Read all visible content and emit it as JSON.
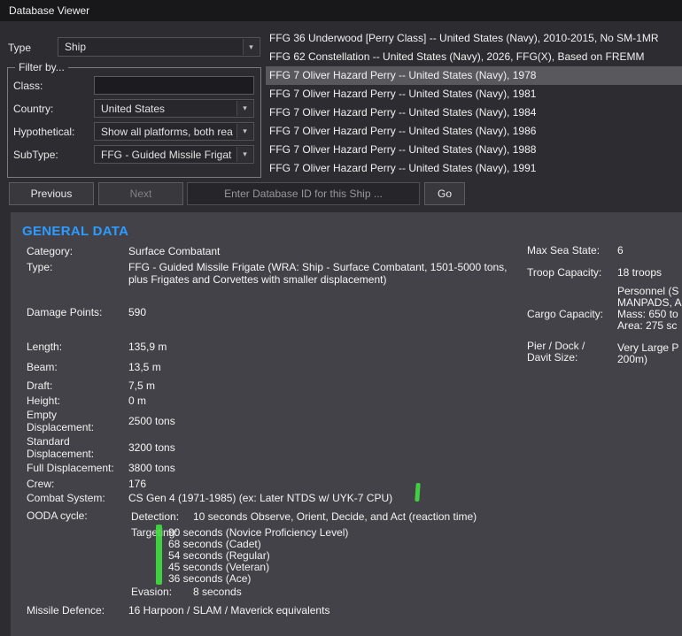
{
  "window": {
    "title": "Database Viewer"
  },
  "icons": {
    "chevron_down": "▾"
  },
  "filters": {
    "type_label": "Type",
    "type_value": "Ship",
    "group_title": "Filter by...",
    "class_label": "Class:",
    "country_label": "Country:",
    "country_value": "United States",
    "hypothetical_label": "Hypothetical:",
    "hypothetical_value": "Show all platforms, both rea",
    "subtype_label": "SubType:",
    "subtype_value": "FFG - Guided Missile Frigat"
  },
  "ship_list": {
    "selected_index": 2,
    "items": [
      "FFG 36 Underwood [Perry Class] -- United States (Navy), 2010-2015, No SM-1MR",
      "FFG 62 Constellation -- United States (Navy), 2026, FFG(X), Based on FREMM",
      "FFG 7 Oliver Hazard Perry -- United States (Navy), 1978",
      "FFG 7 Oliver Hazard Perry -- United States (Navy), 1981",
      "FFG 7 Oliver Hazard Perry -- United States (Navy), 1984",
      "FFG 7 Oliver Hazard Perry -- United States (Navy), 1986",
      "FFG 7 Oliver Hazard Perry -- United States (Navy), 1988",
      "FFG 7 Oliver Hazard Perry -- United States (Navy), 1991"
    ]
  },
  "toolbar": {
    "previous_label": "Previous",
    "next_label": "Next",
    "db_id_placeholder": "Enter Database ID for this Ship ...",
    "go_label": "Go"
  },
  "general_data": {
    "heading": "GENERAL DATA",
    "left": [
      {
        "label": "Category:",
        "value": "Surface Combatant"
      },
      {
        "label": "Type:",
        "value": "FFG - Guided Missile Frigate (WRA: Ship - Surface Combatant, 1501-5000 tons, plus Frigates and Corvettes with smaller displacement)"
      },
      {
        "label": "Damage Points:",
        "value": "590"
      },
      {
        "label": "Length:",
        "value": "135,9 m"
      },
      {
        "label": "Beam:",
        "value": "13,5 m"
      },
      {
        "label": "Draft:",
        "value": "7,5 m"
      },
      {
        "label": "Height:",
        "value": "0 m"
      },
      {
        "label": "Empty\nDisplacement:",
        "value": "2500 tons"
      },
      {
        "label": "Standard\nDisplacement:",
        "value": "3200 tons"
      },
      {
        "label": "Full Displacement:",
        "value": "3800 tons"
      },
      {
        "label": "Crew:",
        "value": "176"
      },
      {
        "label": "Combat System:",
        "value": "CS Gen 4 (1971-1985) (ex: Later NTDS w/ UYK-7 CPU)"
      }
    ],
    "ooda": {
      "label": "OODA cycle:",
      "detection_label": "Detection:",
      "detection_value": "10 seconds Observe, Orient, Decide, and Act (reaction time)",
      "targeting_label": "Targeting:",
      "targeting_value": "90 seconds (Novice Proficiency Level)",
      "targeting_levels": [
        "68 seconds (Cadet)",
        "54 seconds (Regular)",
        "45 seconds (Veteran)",
        "36 seconds (Ace)"
      ],
      "evasion_label": "Evasion:",
      "evasion_value": "8 seconds"
    },
    "missile_defence": {
      "label": "Missile Defence:",
      "value": "16 Harpoon / SLAM / Maverick equivalents"
    },
    "right": [
      {
        "label": "Max Sea State:",
        "value": "6"
      },
      {
        "label": "Troop Capacity:",
        "value": "18 troops"
      },
      {
        "label": "Cargo Capacity:",
        "value": "Personnel (S\nMANPADS, A\nMass: 650 to\nArea: 275 sc"
      },
      {
        "label": "Pier / Dock /\nDavit Size:",
        "value": "Very Large P\n200m)"
      }
    ]
  },
  "colors": {
    "accent_blue": "#2e9bff",
    "highlight_green": "#3fe23f",
    "selected_row": "#59595d"
  }
}
